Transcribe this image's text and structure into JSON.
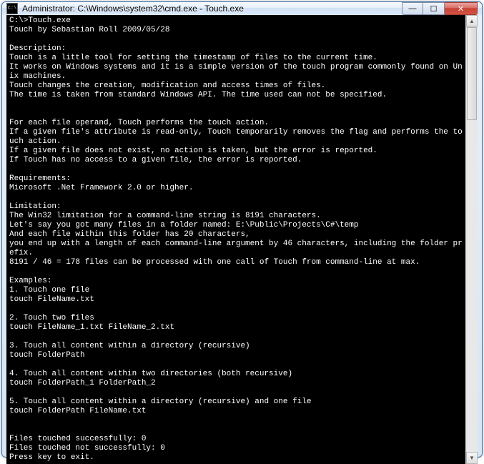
{
  "window": {
    "title": "Administrator: C:\\Windows\\system32\\cmd.exe - Touch.exe"
  },
  "console": {
    "prompt": "C:\\>",
    "command": "Touch.exe",
    "lines": [
      "Touch by Sebastian Roll 2009/05/28",
      "",
      "Description:",
      "Touch is a little tool for setting the timestamp of files to the current time.",
      "It works on Windows systems and it is a simple version of the touch program commonly found on Unix machines.",
      "Touch changes the creation, modification and access times of files.",
      "The time is taken from standard Windows API. The time used can not be specified.",
      "",
      "",
      "For each file operand, Touch performs the touch action.",
      "If a given file's attribute is read-only, Touch temporarily removes the flag and performs the touch action.",
      "If a given file does not exist, no action is taken, but the error is reported.",
      "If Touch has no access to a given file, the error is reported.",
      "",
      "Requirements:",
      "Microsoft .Net Framework 2.0 or higher.",
      "",
      "Limitation:",
      "The Win32 limitation for a command-line string is 8191 characters.",
      "Let's say you got many files in a folder named: E:\\Public\\Projects\\C#\\temp",
      "And each file within this folder has 20 characters,",
      "you end up with a length of each command-line argument by 46 characters, including the folder prefix.",
      "8191 / 46 = 178 files can be processed with one call of Touch from command-line at max.",
      "",
      "Examples:",
      "1. Touch one file",
      "touch FileName.txt",
      "",
      "2. Touch two files",
      "touch FileName_1.txt FileName_2.txt",
      "",
      "3. Touch all content within a directory (recursive)",
      "touch FolderPath",
      "",
      "4. Touch all content within two directories (both recursive)",
      "touch FolderPath_1 FolderPath_2",
      "",
      "5. Touch all content within a directory (recursive) and one file",
      "touch FolderPath FileName.txt",
      "",
      "",
      "Files touched successfully: 0",
      "Files touched not successfully: 0",
      "Press key to exit."
    ]
  },
  "icons": {
    "cmd": "C:\\",
    "minimize": "—",
    "maximize": "☐",
    "close": "✕",
    "up": "▲",
    "down": "▼"
  }
}
